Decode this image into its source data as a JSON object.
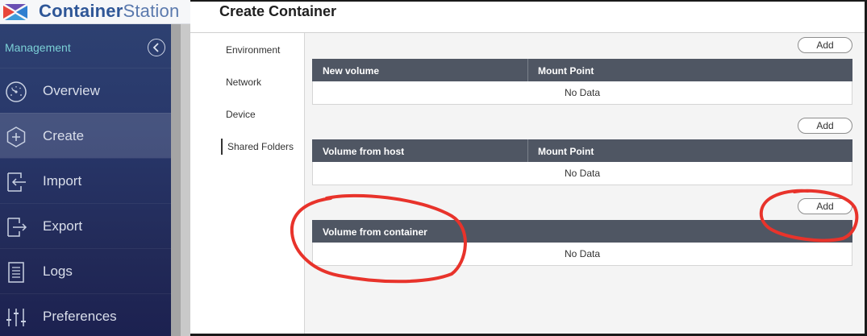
{
  "app": {
    "name_bold": "Container",
    "name_light": "Station"
  },
  "sidebar": {
    "section_label": "Management",
    "items": [
      {
        "label": "Overview",
        "icon": "dashboard-gauge-icon"
      },
      {
        "label": "Create",
        "icon": "plus-circle-icon",
        "active": true
      },
      {
        "label": "Import",
        "icon": "import-arrow-icon"
      },
      {
        "label": "Export",
        "icon": "export-arrow-icon"
      },
      {
        "label": "Logs",
        "icon": "document-list-icon"
      },
      {
        "label": "Preferences",
        "icon": "sliders-icon"
      }
    ]
  },
  "dialog": {
    "title": "Create Container",
    "menu": [
      {
        "label": "Environment"
      },
      {
        "label": "Network"
      },
      {
        "label": "Device"
      },
      {
        "label": "Shared Folders",
        "active": true
      }
    ],
    "sections": [
      {
        "add_label": "Add",
        "columns": [
          "New volume",
          "Mount Point"
        ],
        "empty_text": "No Data"
      },
      {
        "add_label": "Add",
        "columns": [
          "Volume from host",
          "Mount Point"
        ],
        "empty_text": "No Data"
      },
      {
        "add_label": "Add",
        "columns": [
          "Volume from container"
        ],
        "empty_text": "No Data"
      }
    ]
  },
  "colors": {
    "sidebar_bg": "#28376a",
    "section_label": "#7bd0d6",
    "table_header": "#4f5663",
    "annotation": "#e8332b"
  }
}
